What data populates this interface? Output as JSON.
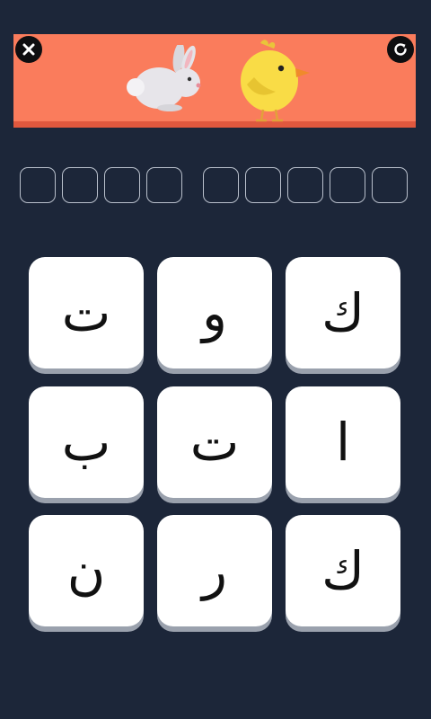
{
  "header": {
    "close_icon": "close-icon",
    "restart_icon": "refresh-icon",
    "pictures": [
      "rabbit",
      "chick"
    ],
    "banner_color": "#fa7c5c"
  },
  "answer": {
    "word_lengths": [
      4,
      5
    ],
    "slots": [
      "",
      "",
      "",
      "",
      "",
      "",
      "",
      "",
      ""
    ]
  },
  "tiles": [
    {
      "letter": "ت"
    },
    {
      "letter": "و"
    },
    {
      "letter": "ك"
    },
    {
      "letter": "ب"
    },
    {
      "letter": "ت"
    },
    {
      "letter": "ا"
    },
    {
      "letter": "ن"
    },
    {
      "letter": "ر"
    },
    {
      "letter": "ك"
    }
  ],
  "colors": {
    "background": "#1c2639",
    "tile": "#ffffff"
  }
}
